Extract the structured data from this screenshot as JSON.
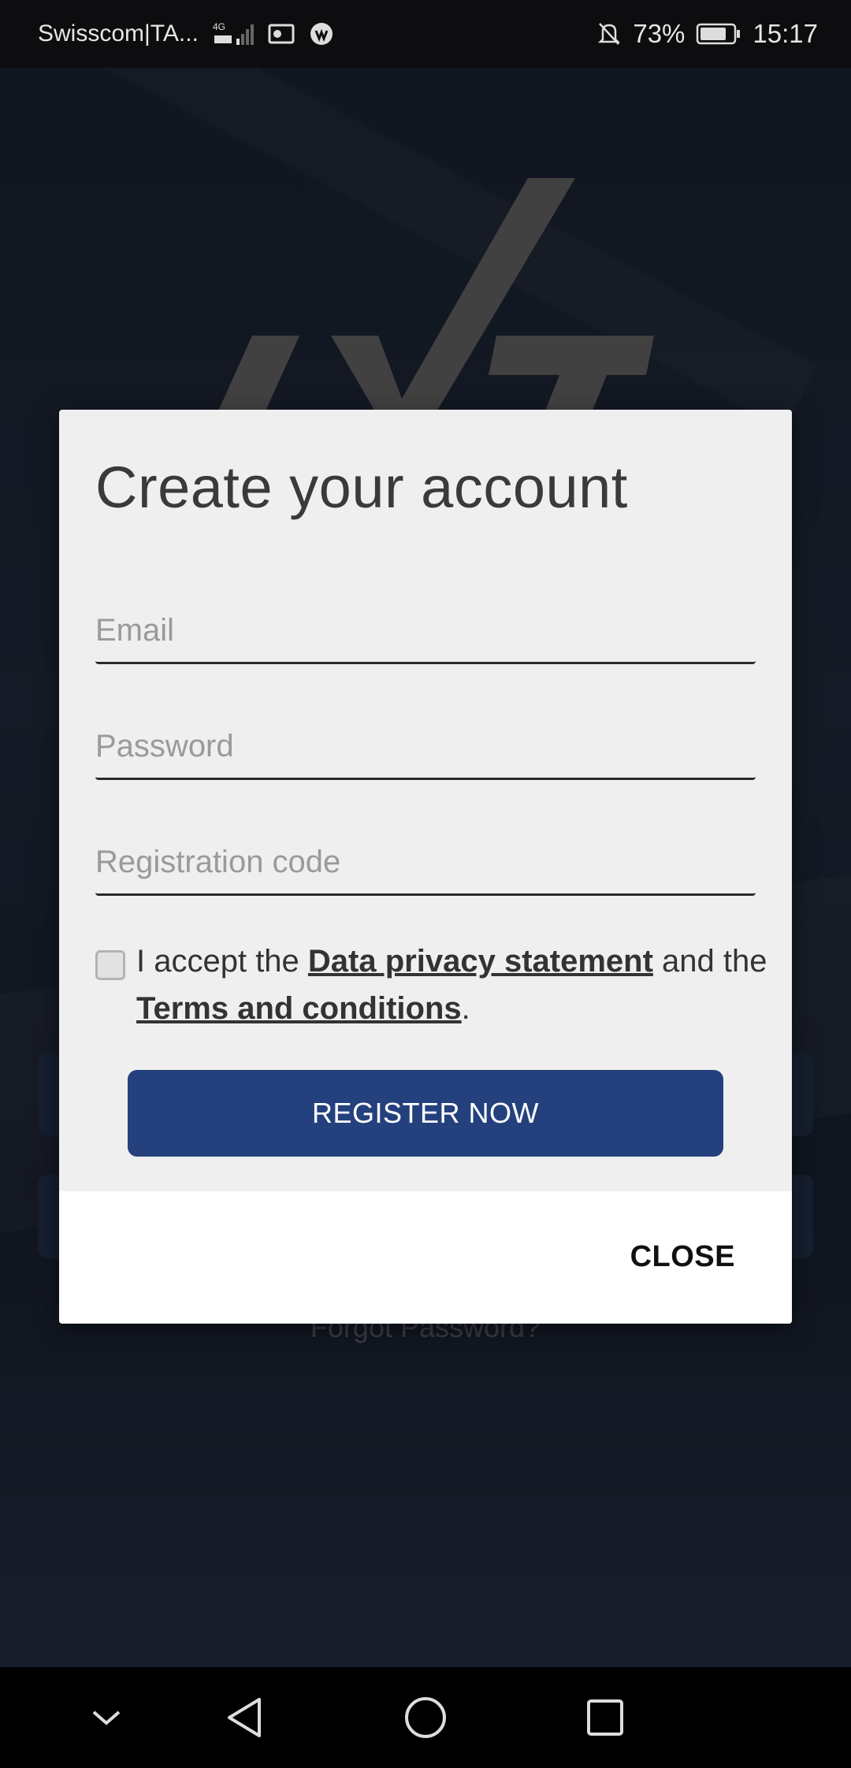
{
  "status_bar": {
    "carrier": "Swisscom|TA...",
    "network": "4G",
    "battery": "73%",
    "time": "15:17"
  },
  "background": {
    "forgot_password": "Forgot Password?"
  },
  "dialog": {
    "title": "Create your account",
    "email_placeholder": "Email",
    "password_placeholder": "Password",
    "registration_placeholder": "Registration code",
    "accept_prefix": "I accept the ",
    "privacy_link": "Data privacy statement",
    "accept_middle": " and the ",
    "terms_link": "Terms and conditions",
    "accept_suffix": ".",
    "register_button": "REGISTER NOW",
    "close_button": "CLOSE"
  },
  "colors": {
    "primary_button": "#24417e",
    "dialog_bg": "#efefef",
    "status_bar_bg": "#0d0d0f"
  }
}
